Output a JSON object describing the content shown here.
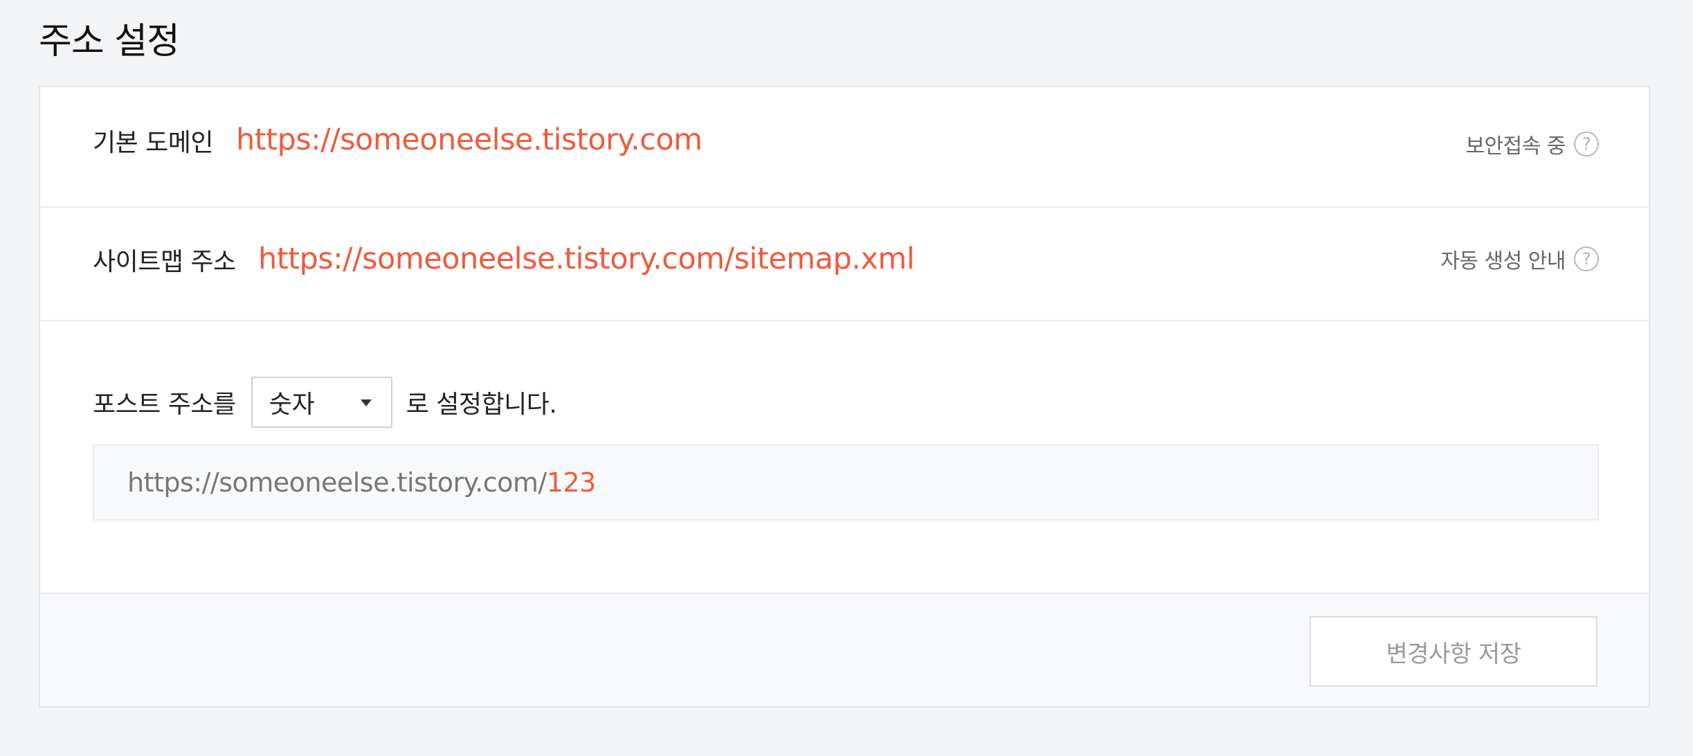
{
  "page": {
    "title": "주소 설정"
  },
  "domain_row": {
    "label": "기본 도메인",
    "value": "https://someoneelse.tistory.com",
    "status_text": "보안접속 중",
    "help_icon": "question-circle-icon"
  },
  "sitemap_row": {
    "label": "사이트맵 주소",
    "value": "https://someoneelse.tistory.com/sitemap.xml",
    "status_text": "자동 생성 안내",
    "help_icon": "question-circle-icon"
  },
  "post_address": {
    "prefix_text": "포스트 주소를",
    "select_value": "숫자",
    "suffix_text": "로 설정합니다.",
    "preview_base": "https://someoneelse.tistory.com/",
    "preview_suffix": "123"
  },
  "footer": {
    "save_label": "변경사항 저장"
  },
  "colors": {
    "accent": "#f05a3b",
    "background": "#f3f4f6"
  }
}
